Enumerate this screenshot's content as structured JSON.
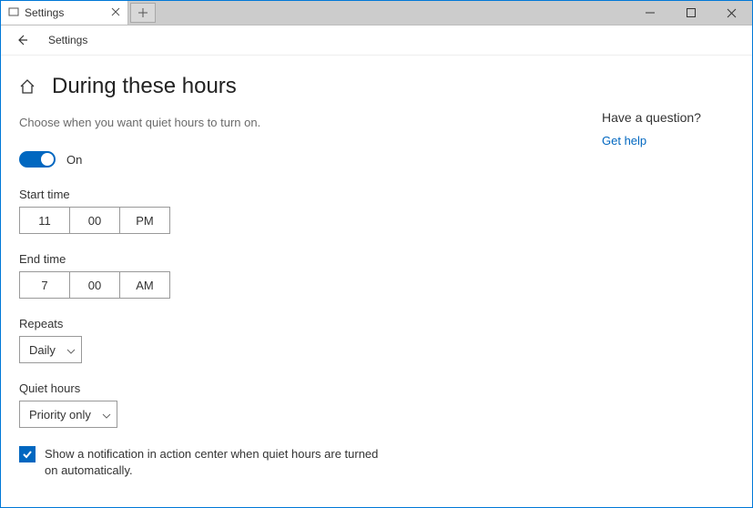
{
  "window": {
    "tab_title": "Settings",
    "breadcrumb": "Settings"
  },
  "page": {
    "title": "During these hours",
    "description": "Choose when you want quiet hours to turn on."
  },
  "toggle": {
    "state": "On"
  },
  "start": {
    "label": "Start time",
    "hour": "11",
    "minute": "00",
    "period": "PM"
  },
  "end": {
    "label": "End time",
    "hour": "7",
    "minute": "00",
    "period": "AM"
  },
  "repeats": {
    "label": "Repeats",
    "value": "Daily"
  },
  "quiet_mode": {
    "label": "Quiet hours",
    "value": "Priority only"
  },
  "notify_checkbox": {
    "checked": true,
    "text": "Show a notification in action center when quiet hours are turned on automatically."
  },
  "side": {
    "heading": "Have a question?",
    "link": "Get help"
  }
}
